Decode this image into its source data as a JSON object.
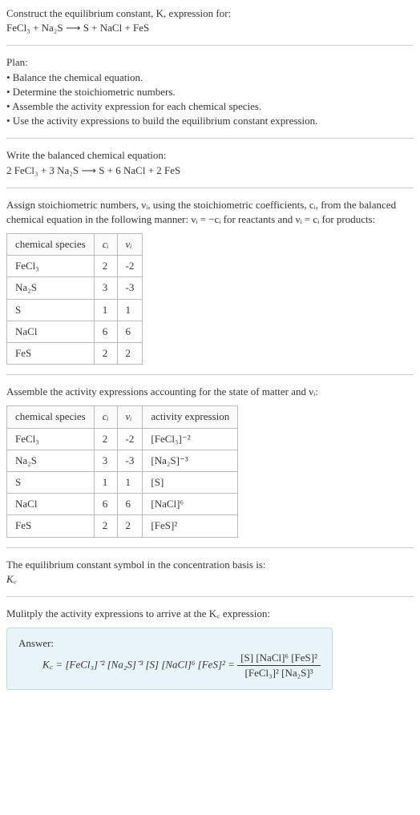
{
  "prompt": {
    "line1": "Construct the equilibrium constant, K, expression for:",
    "equation": "FeCl₃ + Na₂S ⟶ S + NaCl + FeS"
  },
  "plan": {
    "heading": "Plan:",
    "item1": "• Balance the chemical equation.",
    "item2": "• Determine the stoichiometric numbers.",
    "item3": "• Assemble the activity expression for each chemical species.",
    "item4": "• Use the activity expressions to build the equilibrium constant expression."
  },
  "balanced": {
    "heading": "Write the balanced chemical equation:",
    "equation": "2 FeCl₃ + 3 Na₂S ⟶ S + 6 NaCl + 2 FeS"
  },
  "assign": {
    "text": "Assign stoichiometric numbers, νᵢ, using the stoichiometric coefficients, cᵢ, from the balanced chemical equation in the following manner: νᵢ = −cᵢ for reactants and νᵢ = cᵢ for products:"
  },
  "table1": {
    "headers": {
      "species": "chemical species",
      "ci": "cᵢ",
      "vi": "νᵢ"
    },
    "rows": [
      {
        "species": "FeCl₃",
        "ci": "2",
        "vi": "-2"
      },
      {
        "species": "Na₂S",
        "ci": "3",
        "vi": "-3"
      },
      {
        "species": "S",
        "ci": "1",
        "vi": "1"
      },
      {
        "species": "NaCl",
        "ci": "6",
        "vi": "6"
      },
      {
        "species": "FeS",
        "ci": "2",
        "vi": "2"
      }
    ]
  },
  "assemble": {
    "text": "Assemble the activity expressions accounting for the state of matter and νᵢ:"
  },
  "table2": {
    "headers": {
      "species": "chemical species",
      "ci": "cᵢ",
      "vi": "νᵢ",
      "activity": "activity expression"
    },
    "rows": [
      {
        "species": "FeCl₃",
        "ci": "2",
        "vi": "-2",
        "activity": "[FeCl₃]⁻²"
      },
      {
        "species": "Na₂S",
        "ci": "3",
        "vi": "-3",
        "activity": "[Na₂S]⁻³"
      },
      {
        "species": "S",
        "ci": "1",
        "vi": "1",
        "activity": "[S]"
      },
      {
        "species": "NaCl",
        "ci": "6",
        "vi": "6",
        "activity": "[NaCl]⁶"
      },
      {
        "species": "FeS",
        "ci": "2",
        "vi": "2",
        "activity": "[FeS]²"
      }
    ]
  },
  "symbol": {
    "text": "The equilibrium constant symbol in the concentration basis is:",
    "var": "K꜀"
  },
  "multiply": {
    "text": "Mulitply the activity expressions to arrive at the K꜀ expression:"
  },
  "answer": {
    "label": "Answer:",
    "lhs": "K꜀ = [FeCl₃]⁻² [Na₂S]⁻³ [S] [NaCl]⁶ [FeS]² = ",
    "num": "[S] [NaCl]⁶ [FeS]²",
    "den": "[FeCl₃]² [Na₂S]³"
  },
  "chart_data": {
    "type": "table",
    "title": "Stoichiometric data for equilibrium constant",
    "tables": [
      {
        "name": "stoichiometric numbers",
        "columns": [
          "chemical species",
          "cᵢ",
          "νᵢ"
        ],
        "rows": [
          [
            "FeCl₃",
            2,
            -2
          ],
          [
            "Na₂S",
            3,
            -3
          ],
          [
            "S",
            1,
            1
          ],
          [
            "NaCl",
            6,
            6
          ],
          [
            "FeS",
            2,
            2
          ]
        ]
      },
      {
        "name": "activity expressions",
        "columns": [
          "chemical species",
          "cᵢ",
          "νᵢ",
          "activity expression"
        ],
        "rows": [
          [
            "FeCl₃",
            2,
            -2,
            "[FeCl₃]⁻²"
          ],
          [
            "Na₂S",
            3,
            -3,
            "[Na₂S]⁻³"
          ],
          [
            "S",
            1,
            1,
            "[S]"
          ],
          [
            "NaCl",
            6,
            6,
            "[NaCl]⁶"
          ],
          [
            "FeS",
            2,
            2,
            "[FeS]²"
          ]
        ]
      }
    ]
  }
}
